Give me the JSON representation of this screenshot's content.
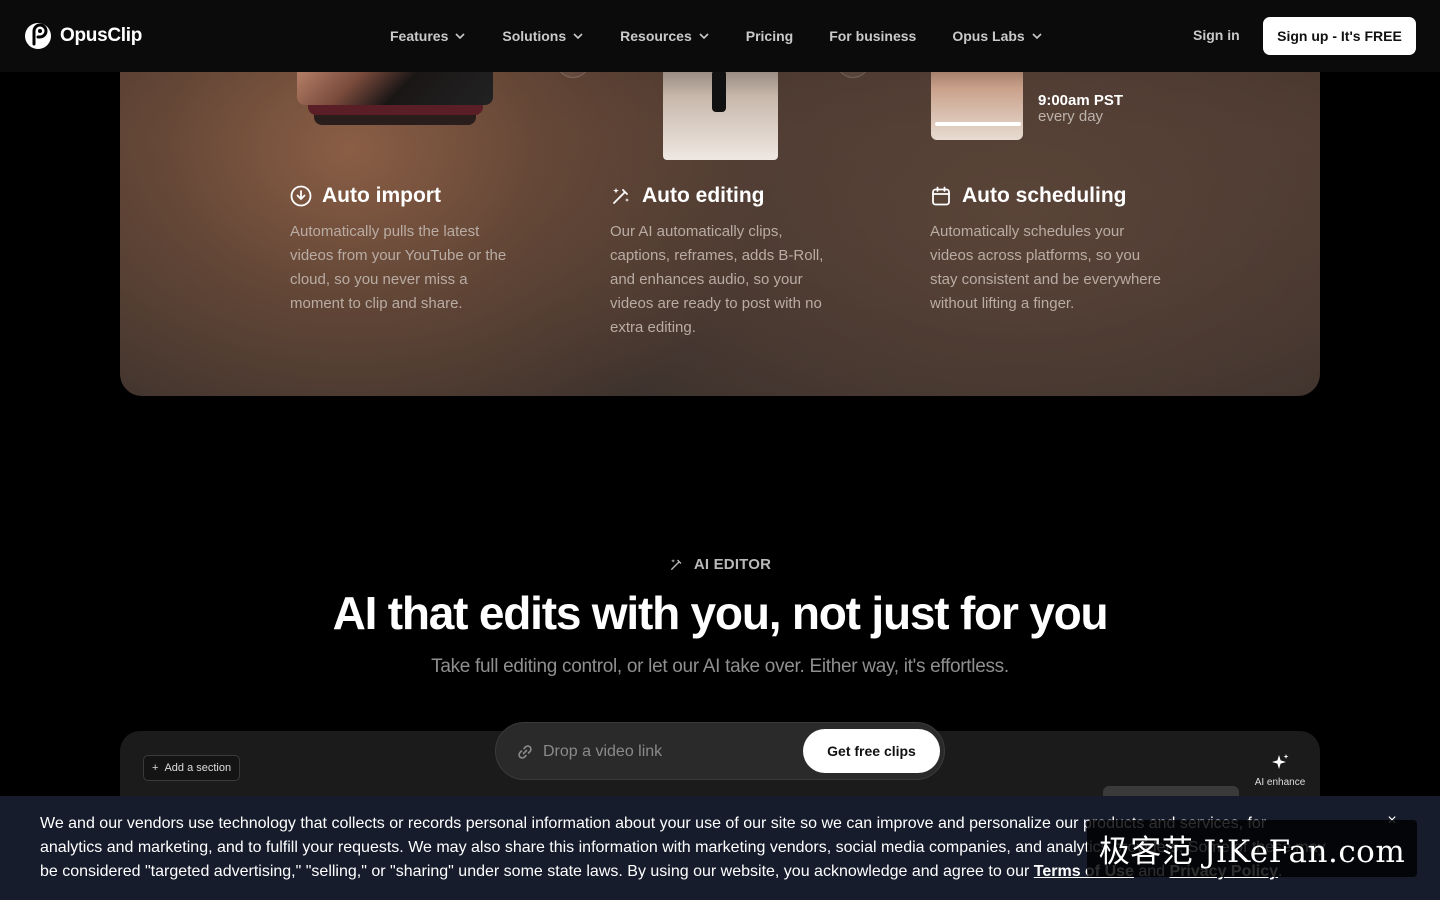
{
  "nav": {
    "brand": "OpusClip",
    "items": [
      {
        "label": "Features",
        "dropdown": true
      },
      {
        "label": "Solutions",
        "dropdown": true
      },
      {
        "label": "Resources",
        "dropdown": true
      },
      {
        "label": "Pricing",
        "dropdown": false
      },
      {
        "label": "For business",
        "dropdown": false
      },
      {
        "label": "Opus Labs",
        "dropdown": true
      }
    ],
    "signin": "Sign in",
    "signup": "Sign up - It's FREE"
  },
  "features": {
    "schedule_time": "9:00am PST",
    "schedule_freq": "every day",
    "cards": [
      {
        "icon": "download-circle-icon",
        "title": "Auto import",
        "desc": "Automatically pulls the latest videos from your YouTube or the cloud, so you never miss a moment to clip and share."
      },
      {
        "icon": "magic-wand-icon",
        "title": "Auto editing",
        "desc": "Our AI automatically clips, captions, reframes, adds B-Roll, and enhances audio, so your videos are ready to post with no extra editing."
      },
      {
        "icon": "calendar-icon",
        "title": "Auto scheduling",
        "desc": "Automatically schedules your videos across platforms, so you stay consistent and be everywhere without lifting a finger."
      }
    ]
  },
  "ai_editor": {
    "eyebrow": "AI EDITOR",
    "headline": "AI that edits with you, not just for you",
    "subline": "Take full editing control, or let our AI take over. Either way, it's effortless.",
    "add_section": "Add a section",
    "ai_enhance": "AI enhance",
    "drop_placeholder": "Drop a video link",
    "cta": "Get free clips"
  },
  "cookie": {
    "text_before": "We and our vendors use technology that collects or records personal information about your use of our site so we can improve and personalize our products and services, for analytics and marketing, and to fulfill your requests. We may also share this information with marketing vendors, social media companies, and analytics providers. Some of these may be considered \"targeted advertising,\" \"selling,\" or \"sharing\" under some state laws. By using our website, you acknowledge and agree to our ",
    "terms": "Terms of Use",
    "and": " and ",
    "privacy": "Privacy Policy",
    "end": ".",
    "close": "×"
  },
  "watermark": "极客范 JiKeFan.com"
}
